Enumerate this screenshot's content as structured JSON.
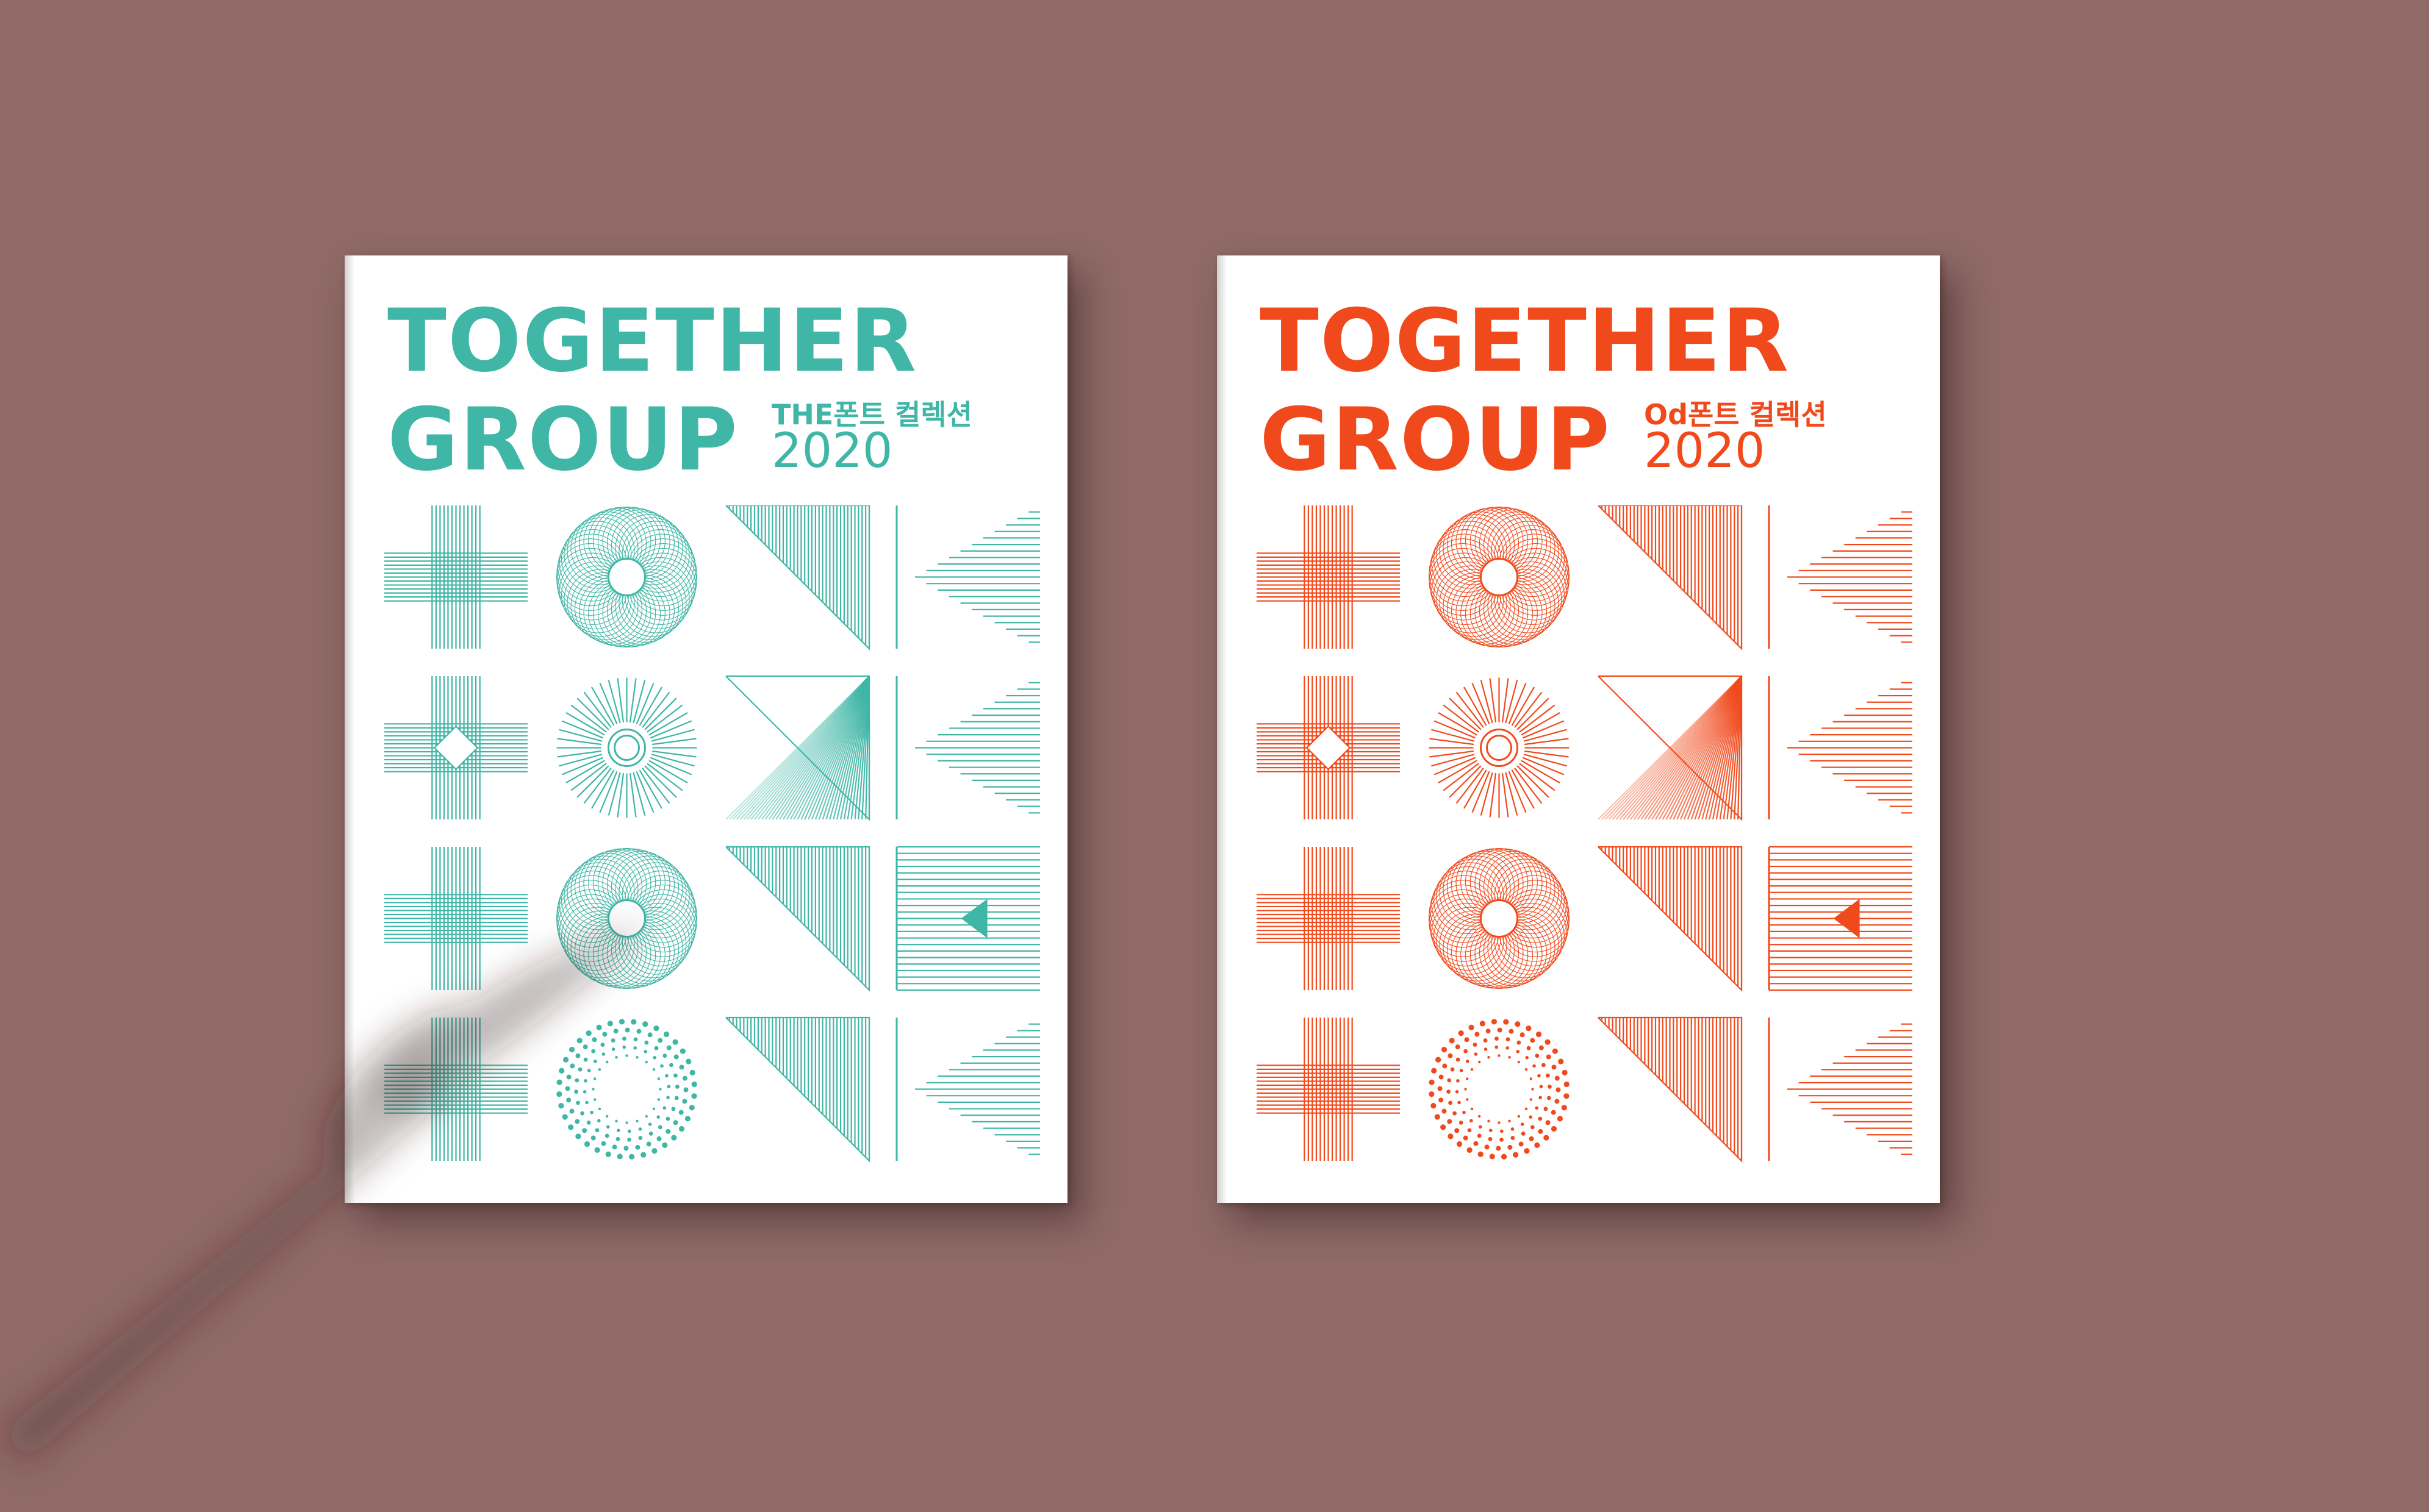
{
  "scene": {
    "wall_color": "#8f6a67",
    "books": [
      {
        "title_line1": "TOGETHER",
        "title_line2": "GROUP",
        "subtitle": "THE폰트 컬렉션",
        "year": "2020",
        "color": "#3fb6a6"
      },
      {
        "title_line1": "TOGETHER",
        "title_line2": "GROUP",
        "subtitle": "Od폰트 컬렉션",
        "year": "2020",
        "color": "#f04a1c"
      }
    ]
  }
}
